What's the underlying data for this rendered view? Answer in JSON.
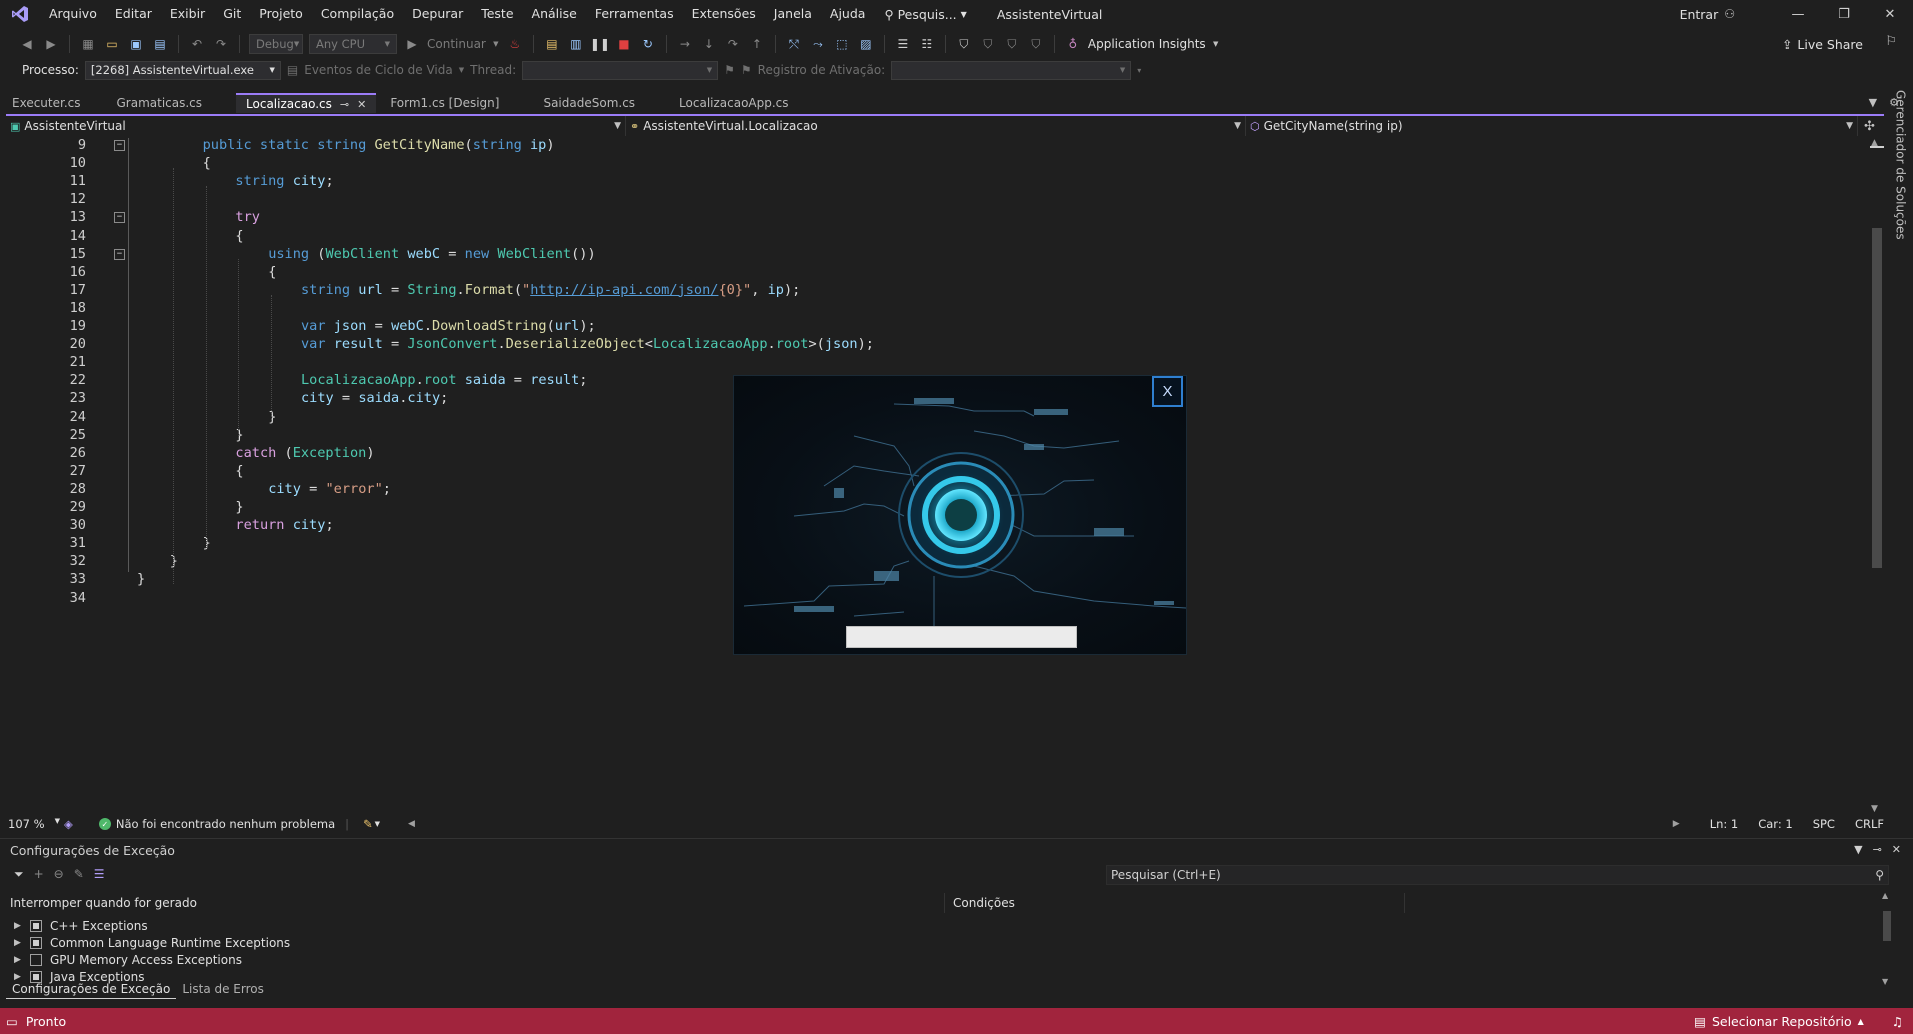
{
  "colors": {
    "accent": "#9b7cf7",
    "statusbar": "#a1243d",
    "keyword": "#569cd6",
    "control": "#d8a0df",
    "type": "#4ec9b0",
    "method": "#dcdcaa",
    "string": "#d69d85",
    "variable": "#9cdcfe"
  },
  "menu": {
    "items": [
      "Arquivo",
      "Editar",
      "Exibir",
      "Git",
      "Projeto",
      "Compilação",
      "Depurar",
      "Teste",
      "Análise",
      "Ferramentas",
      "Extensões",
      "Janela",
      "Ajuda"
    ],
    "search_label": "Pesquis...",
    "solution_title": "AssistenteVirtual",
    "signin_label": "Entrar"
  },
  "toolbar": {
    "config": "Debug",
    "platform": "Any CPU",
    "continue_label": "Continuar",
    "insights_label": "Application Insights",
    "liveshare_label": "Live Share"
  },
  "procbar": {
    "process_label": "Processo:",
    "process_value": "[2268] AssistenteVirtual.exe",
    "lifecycle_label": "Eventos de Ciclo de Vida",
    "thread_label": "Thread:",
    "stackframe_label": "Registro de Ativação:"
  },
  "tabs": [
    {
      "label": "Executer.cs",
      "active": false
    },
    {
      "label": "Gramaticas.cs",
      "active": false
    },
    {
      "label": "Localizacao.cs",
      "active": true
    },
    {
      "label": "Form1.cs [Design]",
      "active": false
    },
    {
      "label": "SaidadeSom.cs",
      "active": false
    },
    {
      "label": "LocalizacaoApp.cs",
      "active": false
    }
  ],
  "navbar": {
    "project": "AssistenteVirtual",
    "type": "AssistenteVirtual.Localizacao",
    "member": "GetCityName(string ip)"
  },
  "editor": {
    "lines": [
      {
        "n": "9",
        "indent": 2,
        "fold": true,
        "tokens": [
          [
            "kw",
            "public"
          ],
          [
            "p",
            " "
          ],
          [
            "kw",
            "static"
          ],
          [
            "p",
            " "
          ],
          [
            "kw",
            "string"
          ],
          [
            "p",
            " "
          ],
          [
            "fn",
            "GetCityName"
          ],
          [
            "p",
            "("
          ],
          [
            "kw",
            "string"
          ],
          [
            "p",
            " "
          ],
          [
            "var",
            "ip"
          ],
          [
            "p",
            ")"
          ]
        ]
      },
      {
        "n": "10",
        "indent": 2,
        "tokens": [
          [
            "p",
            "{"
          ]
        ]
      },
      {
        "n": "11",
        "indent": 3,
        "tokens": [
          [
            "kw",
            "string"
          ],
          [
            "p",
            " "
          ],
          [
            "var",
            "city"
          ],
          [
            "p",
            ";"
          ]
        ]
      },
      {
        "n": "12",
        "indent": 0,
        "tokens": []
      },
      {
        "n": "13",
        "indent": 3,
        "fold": true,
        "tokens": [
          [
            "ctl",
            "try"
          ]
        ]
      },
      {
        "n": "14",
        "indent": 3,
        "tokens": [
          [
            "p",
            "{"
          ]
        ]
      },
      {
        "n": "15",
        "indent": 4,
        "fold": true,
        "tokens": [
          [
            "kw",
            "using"
          ],
          [
            "p",
            " ("
          ],
          [
            "ty",
            "WebClient"
          ],
          [
            "p",
            " "
          ],
          [
            "var",
            "webC"
          ],
          [
            "p",
            " = "
          ],
          [
            "kw",
            "new"
          ],
          [
            "p",
            " "
          ],
          [
            "ty",
            "WebClient"
          ],
          [
            "p",
            "())"
          ]
        ]
      },
      {
        "n": "16",
        "indent": 4,
        "tokens": [
          [
            "p",
            "{"
          ]
        ]
      },
      {
        "n": "17",
        "indent": 5,
        "tokens": [
          [
            "kw",
            "string"
          ],
          [
            "p",
            " "
          ],
          [
            "var",
            "url"
          ],
          [
            "p",
            " = "
          ],
          [
            "ty",
            "String"
          ],
          [
            "p",
            "."
          ],
          [
            "fn",
            "Format"
          ],
          [
            "p",
            "("
          ],
          [
            "str",
            "\""
          ],
          [
            "url",
            "http://ip-api.com/json/"
          ],
          [
            "str",
            "{0}\""
          ],
          [
            "p",
            ", "
          ],
          [
            "var",
            "ip"
          ],
          [
            "p",
            ");"
          ]
        ]
      },
      {
        "n": "18",
        "indent": 0,
        "tokens": []
      },
      {
        "n": "19",
        "indent": 5,
        "tokens": [
          [
            "kw",
            "var"
          ],
          [
            "p",
            " "
          ],
          [
            "var",
            "json"
          ],
          [
            "p",
            " = "
          ],
          [
            "var",
            "webC"
          ],
          [
            "p",
            "."
          ],
          [
            "fn",
            "DownloadString"
          ],
          [
            "p",
            "("
          ],
          [
            "var",
            "url"
          ],
          [
            "p",
            ");"
          ]
        ]
      },
      {
        "n": "20",
        "indent": 5,
        "tokens": [
          [
            "kw",
            "var"
          ],
          [
            "p",
            " "
          ],
          [
            "var",
            "result"
          ],
          [
            "p",
            " = "
          ],
          [
            "ty",
            "JsonConvert"
          ],
          [
            "p",
            "."
          ],
          [
            "fn",
            "DeserializeObject"
          ],
          [
            "p",
            "<"
          ],
          [
            "ty",
            "LocalizacaoApp"
          ],
          [
            "p",
            "."
          ],
          [
            "ty",
            "root"
          ],
          [
            "p",
            ">("
          ],
          [
            "var",
            "json"
          ],
          [
            "p",
            ");"
          ]
        ]
      },
      {
        "n": "21",
        "indent": 0,
        "tokens": []
      },
      {
        "n": "22",
        "indent": 5,
        "tokens": [
          [
            "ty",
            "LocalizacaoApp"
          ],
          [
            "p",
            "."
          ],
          [
            "ty",
            "root"
          ],
          [
            "p",
            " "
          ],
          [
            "var",
            "saida"
          ],
          [
            "p",
            " = "
          ],
          [
            "var",
            "result"
          ],
          [
            "p",
            ";"
          ]
        ]
      },
      {
        "n": "23",
        "indent": 5,
        "tokens": [
          [
            "var",
            "city"
          ],
          [
            "p",
            " = "
          ],
          [
            "var",
            "saida"
          ],
          [
            "p",
            "."
          ],
          [
            "var",
            "city"
          ],
          [
            "p",
            ";"
          ]
        ]
      },
      {
        "n": "24",
        "indent": 4,
        "tokens": [
          [
            "p",
            "}"
          ]
        ]
      },
      {
        "n": "25",
        "indent": 3,
        "tokens": [
          [
            "p",
            "}"
          ]
        ]
      },
      {
        "n": "26",
        "indent": 3,
        "tokens": [
          [
            "ctl",
            "catch"
          ],
          [
            "p",
            " ("
          ],
          [
            "ty",
            "Exception"
          ],
          [
            "p",
            ")"
          ]
        ]
      },
      {
        "n": "27",
        "indent": 3,
        "tokens": [
          [
            "p",
            "{"
          ]
        ]
      },
      {
        "n": "28",
        "indent": 4,
        "tokens": [
          [
            "var",
            "city"
          ],
          [
            "p",
            " = "
          ],
          [
            "str",
            "\"error\""
          ],
          [
            "p",
            ";"
          ]
        ]
      },
      {
        "n": "29",
        "indent": 3,
        "tokens": [
          [
            "p",
            "}"
          ]
        ]
      },
      {
        "n": "30",
        "indent": 3,
        "tokens": [
          [
            "ctl",
            "return"
          ],
          [
            "p",
            " "
          ],
          [
            "var",
            "city"
          ],
          [
            "p",
            ";"
          ]
        ]
      },
      {
        "n": "31",
        "indent": 2,
        "tokens": [
          [
            "p",
            "}"
          ]
        ]
      },
      {
        "n": "32",
        "indent": 1,
        "tokens": [
          [
            "p",
            "}"
          ]
        ]
      },
      {
        "n": "33",
        "indent": 0,
        "tokens": [
          [
            "p",
            "}"
          ]
        ]
      },
      {
        "n": "34",
        "indent": 0,
        "tokens": []
      }
    ]
  },
  "editor_status": {
    "zoom": "107 %",
    "issues": "Não foi encontrado nenhum problema",
    "line": "Ln: 1",
    "char": "Car: 1",
    "spacing": "SPC",
    "eol": "CRLF"
  },
  "splash": {
    "close_label": "X",
    "input_value": ""
  },
  "exceptions": {
    "title": "Configurações de Exceção",
    "search_placeholder": "Pesquisar (Ctrl+E)",
    "col_break": "Interromper quando for gerado",
    "col_conditions": "Condições",
    "rows": [
      {
        "label": "C++ Exceptions",
        "state": "partial"
      },
      {
        "label": "Common Language Runtime Exceptions",
        "state": "partial"
      },
      {
        "label": "GPU Memory Access Exceptions",
        "state": "empty"
      },
      {
        "label": "Java Exceptions",
        "state": "partial"
      }
    ],
    "tabs": [
      "Configurações de Exceção",
      "Lista de Erros"
    ]
  },
  "statusbar": {
    "ready": "Pronto",
    "repo": "Selecionar Repositório"
  }
}
